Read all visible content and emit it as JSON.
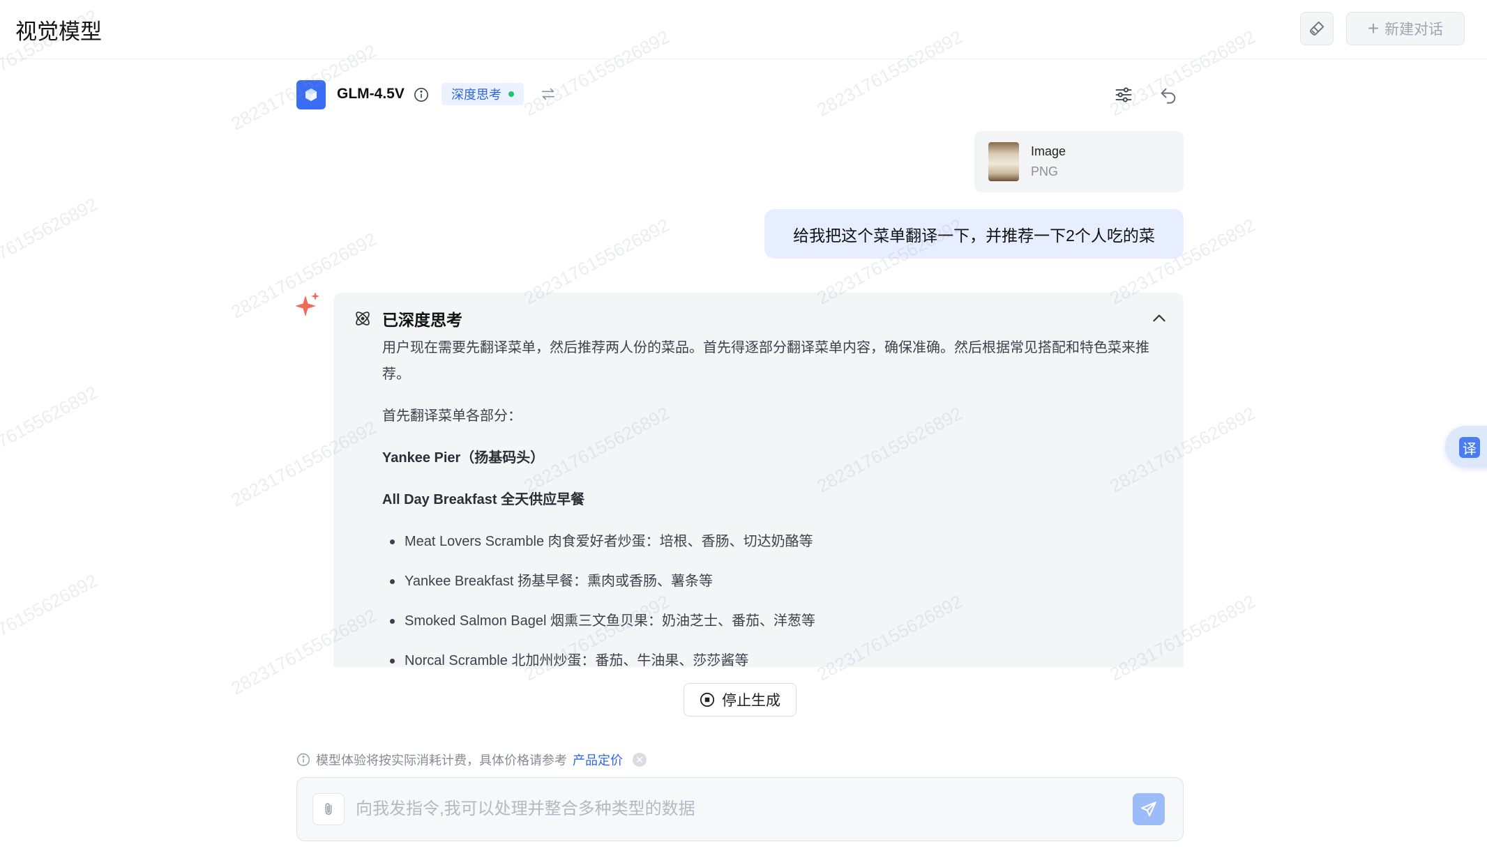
{
  "app": {
    "title": "视觉模型"
  },
  "header": {
    "new_chat_label": "新建对话",
    "icons": [
      "brush-icon",
      "plus-icon"
    ]
  },
  "model": {
    "name": "GLM-4.5V",
    "mode_tag": "深度思考",
    "icons": [
      "cube-icon",
      "info-icon",
      "swap-icon",
      "settings-sliders-icon",
      "undo-icon"
    ]
  },
  "attachment": {
    "name": "Image",
    "type": "PNG"
  },
  "user_message": "给我把这个菜单翻译一下，并推荐一下2个人吃的菜",
  "thinking": {
    "title": "已深度思考",
    "intro": "用户现在需要先翻译菜单，然后推荐两人份的菜品。首先得逐部分翻译菜单内容，确保准确。然后根据常见搭配和特色菜来推荐。",
    "step": "首先翻译菜单各部分：",
    "place": "Yankee Pier（扬基码头）",
    "section": "All Day Breakfast 全天供应早餐",
    "items": [
      "Meat Lovers Scramble 肉食爱好者炒蛋：培根、香肠、切达奶酪等",
      "Yankee Breakfast 扬基早餐：熏肉或香肠、薯条等",
      "Smoked Salmon Bagel 烟熏三文鱼贝果：奶油芝士、番茄、洋葱等",
      "Norcal Scramble 北加州炒蛋：番茄、牛油果、莎莎酱等"
    ]
  },
  "stop_button": "停止生成",
  "notice": {
    "text": "模型体验将按实际消耗计费，具体价格请参考",
    "link": "产品定价"
  },
  "input": {
    "placeholder": "向我发指令,我可以处理并整合多种类型的数据",
    "value": ""
  },
  "translate_button": "译",
  "watermark": "2823176155626892"
}
